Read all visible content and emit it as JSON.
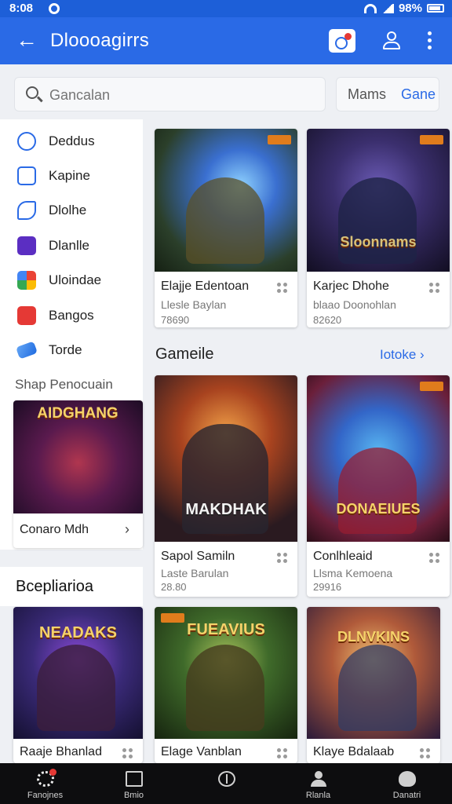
{
  "status_bar": {
    "time": "8:08",
    "battery": "98%"
  },
  "app_bar": {
    "title": "Dloooagirrs"
  },
  "search": {
    "placeholder": "Gancalan"
  },
  "filter": {
    "left": "Mams",
    "right": "Gane"
  },
  "sidebar": {
    "items": [
      {
        "label": "Deddus",
        "icon": "settings-ring-icon"
      },
      {
        "label": "Kapine",
        "icon": "frame-icon"
      },
      {
        "label": "Dlolhe",
        "icon": "phone-icon"
      },
      {
        "label": "Dlanlle",
        "icon": "play-store-icon"
      },
      {
        "label": "Uloindae",
        "icon": "google-icon"
      },
      {
        "label": "Bangos",
        "icon": "red-diamond-icon"
      },
      {
        "label": "Torde",
        "icon": "blue-tag-icon"
      }
    ],
    "shop_title": "Shap Penocuain",
    "promo": {
      "banner": "AIDGHANG",
      "label": "Conaro Mdh"
    }
  },
  "top_cards": [
    {
      "name": "Elajje Edentoan",
      "sub": "Llesle Baylan",
      "price": "78690",
      "banner": ""
    },
    {
      "name": "Karjec Dhohe",
      "sub": "blaao Doonohlan",
      "price": "82620",
      "banner": "Sloonnams"
    }
  ],
  "section_games": {
    "title": "Gameile",
    "more": "Iotoke"
  },
  "game_cards": [
    {
      "name": "Sapol Samiln",
      "sub": "Laste Barulan",
      "price": "28.80",
      "banner": "MAKDHAK"
    },
    {
      "name": "Conlhleaid",
      "sub": "Llsma Kemoena",
      "price": "29916",
      "banner": "DONAEIUES"
    }
  ],
  "section_special": {
    "title": "Bcepliarioa"
  },
  "bottom_cards": [
    {
      "name": "Raaje Bhanlad",
      "banner": "NEADAKS"
    },
    {
      "name": "Elage Vanblan",
      "banner": "FUEAVIUS"
    },
    {
      "name": "Klaye Bdalaab",
      "banner": "DLNVKINS"
    }
  ],
  "bottom_nav": [
    {
      "label": "Fanojnes",
      "icon": "gear-icon"
    },
    {
      "label": "Bmio",
      "icon": "square-icon"
    },
    {
      "label": "",
      "icon": "compass-icon"
    },
    {
      "label": "Rlanla",
      "icon": "person-icon"
    },
    {
      "label": "Danatri",
      "icon": "face-icon"
    }
  ]
}
